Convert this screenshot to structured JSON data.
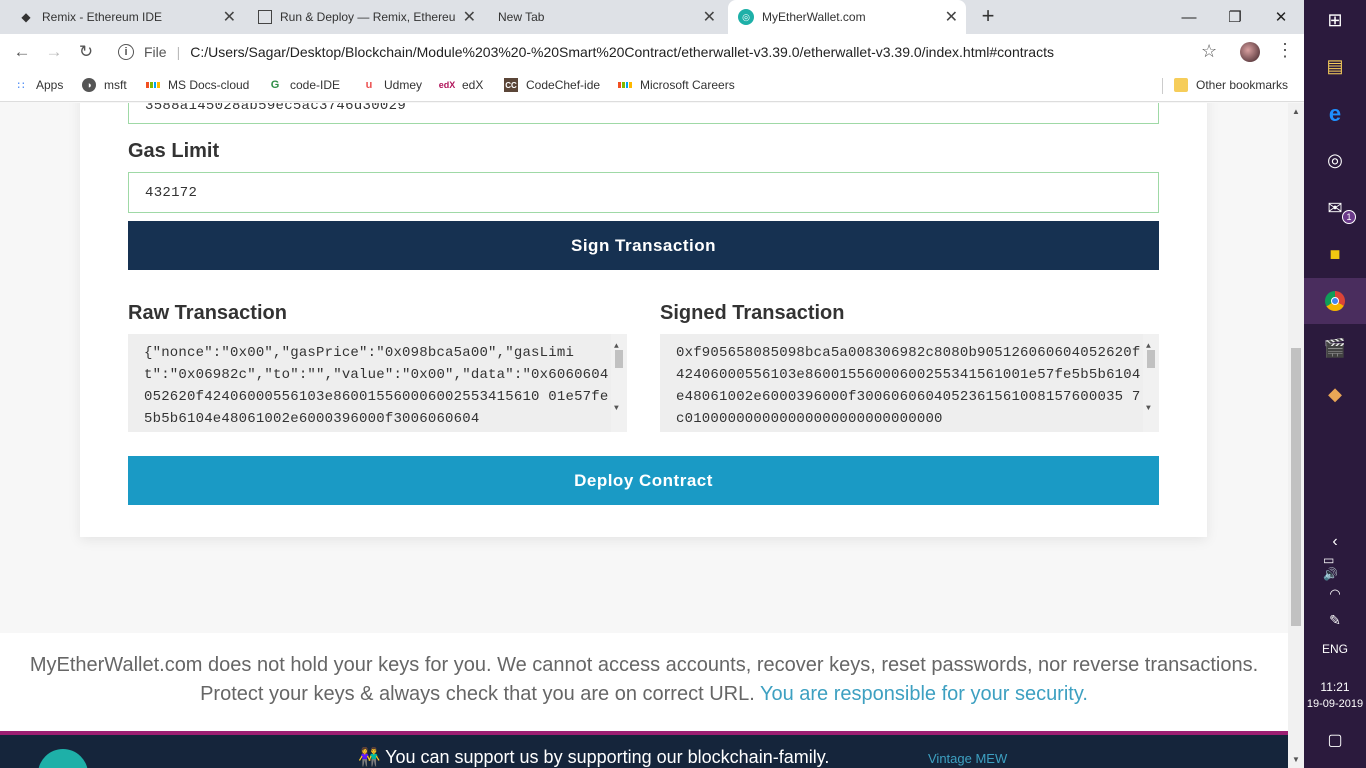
{
  "tabs": [
    {
      "label": "Remix - Ethereum IDE",
      "icon": "ethereum-icon"
    },
    {
      "label": "Run & Deploy — Remix, Ethereum",
      "icon": "document-icon"
    },
    {
      "label": "New Tab",
      "icon": ""
    },
    {
      "label": "MyEtherWallet.com",
      "icon": "mew-icon",
      "active": true
    }
  ],
  "toolbar": {
    "file_label": "File",
    "url": "C:/Users/Sagar/Desktop/Blockchain/Module%203%20-%20Smart%20Contract/etherwallet-v3.39.0/etherwallet-v3.39.0/index.html#contracts"
  },
  "bookmarks": [
    {
      "label": "Apps"
    },
    {
      "label": "msft"
    },
    {
      "label": "MS Docs-cloud"
    },
    {
      "label": "code-IDE"
    },
    {
      "label": "Udmey"
    },
    {
      "label": "edX"
    },
    {
      "label": "CodeChef-ide"
    },
    {
      "label": "Microsoft Careers"
    },
    {
      "label": "Other bookmarks"
    }
  ],
  "form": {
    "bytecode_tail": "3588a145028ab59ec5ac3746d30029",
    "gas_limit_label": "Gas Limit",
    "gas_limit_value": "432172",
    "sign_button": "Sign Transaction",
    "raw_label": "Raw Transaction",
    "raw_value": "{\"nonce\":\"0x00\",\"gasPrice\":\"0x098bca5a00\",\"gasLimit\":\"0x06982c\",\"to\":\"\",\"value\":\"0x00\",\"data\":\"0x6060604052620f42406000556103e860015560006002553415610 01e57fe5b5b6104e48061002e6000396000f3006060604",
    "signed_label": "Signed Transaction",
    "signed_value": "0xf905658085098bca5a008306982c8080b905126060604052620f42406000556103e86001556000600255341561001e57fe5b5b6104e48061002e6000396000f3006060604052361561008157600035 7c010000000000000000000000000000",
    "deploy_button": "Deploy Contract"
  },
  "footer": {
    "note": "MyEtherWallet.com does not hold your keys for you. We cannot access accounts, recover keys, reset passwords, nor reverse transactions. Protect your keys & always check that you are on correct URL.",
    "note_link": "You are responsible for your security.",
    "support": "You can support us by supporting our blockchain-family.",
    "vintage": "Vintage MEW"
  },
  "taskbar": {
    "language": "ENG",
    "time": "11:21",
    "date": "19-09-2019",
    "mail_badge": "1"
  },
  "colors": {
    "sign_button": "#163151",
    "deploy_button": "#1a9ac5",
    "link": "#3da0c1",
    "footer_dark": "#15253b",
    "footer_accent": "#9c1f72"
  }
}
